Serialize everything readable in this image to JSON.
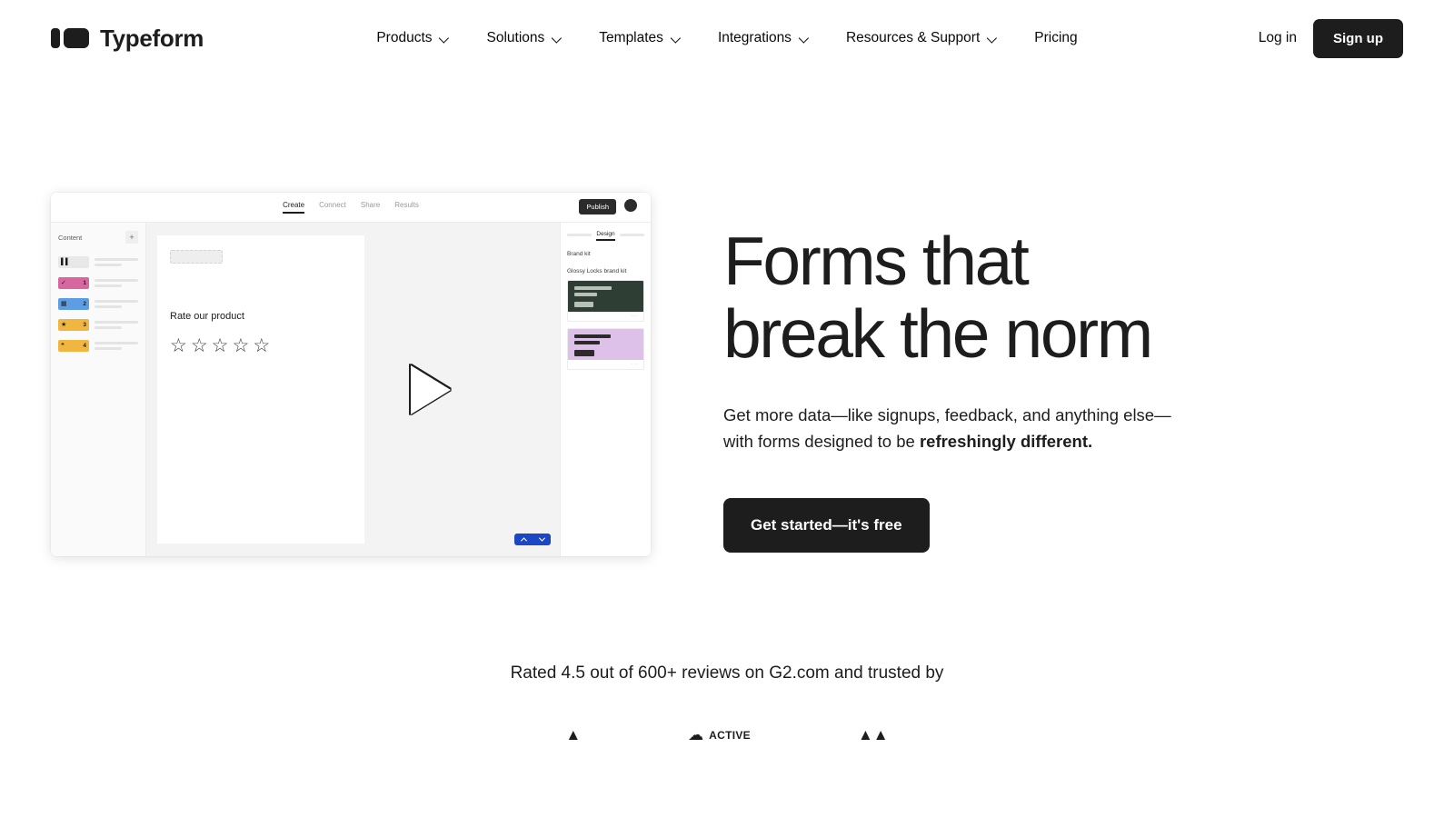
{
  "header": {
    "brand": {
      "name": "Typeform",
      "logo_icon": "typeform-logo-icon"
    },
    "nav": [
      {
        "label": "Products",
        "has_dropdown": true
      },
      {
        "label": "Solutions",
        "has_dropdown": true
      },
      {
        "label": "Templates",
        "has_dropdown": true
      },
      {
        "label": "Integrations",
        "has_dropdown": true
      },
      {
        "label": "Resources & Support",
        "has_dropdown": true
      },
      {
        "label": "Pricing",
        "has_dropdown": false
      }
    ],
    "login_label": "Log in",
    "signup_label": "Sign up"
  },
  "hero": {
    "title_line1": "Forms that",
    "title_line2": "break the norm",
    "sub_plain": "Get more data—like signups, feedback, and anything else—with forms designed to be ",
    "sub_bold": "refreshingly different.",
    "cta_label": "Get started—it's free"
  },
  "mockup": {
    "tabs": [
      {
        "label": "Create",
        "active": true
      },
      {
        "label": "Connect",
        "active": false
      },
      {
        "label": "Share",
        "active": false
      },
      {
        "label": "Results",
        "active": false
      }
    ],
    "publish_label": "Publish",
    "sidebar": {
      "title": "Content",
      "add_label": "+",
      "items": [
        {
          "num": "",
          "icon": "▌▌",
          "color": "#e8e8e8"
        },
        {
          "num": "1",
          "icon": "✓",
          "color": "#d8679f"
        },
        {
          "num": "2",
          "icon": "▦",
          "color": "#5d9de4"
        },
        {
          "num": "3",
          "icon": "★",
          "color": "#f0b63f"
        },
        {
          "num": "4",
          "icon": "❝",
          "color": "#f0b63f"
        }
      ]
    },
    "canvas": {
      "question": "Rate our product",
      "stars": [
        "☆",
        "☆",
        "☆",
        "☆",
        "☆"
      ],
      "nav_up_icon": "chevron-up-icon",
      "nav_down_icon": "chevron-down-icon",
      "accent_color": "#1c47c4"
    },
    "design_panel": {
      "tab_label": "Design",
      "brand_kit_label": "Brand kit",
      "kit_name": "Glossy Locks brand kit",
      "themes": [
        {
          "bg": "#2f3e35",
          "bar": "#b9c0ba"
        },
        {
          "bg": "#ddc1e8",
          "bar": "#2b2b2b"
        }
      ]
    }
  },
  "proof": {
    "text": "Rated 4.5 out of 600+ reviews on G2.com and trusted by",
    "logos": [
      {
        "icon": "▲",
        "label": ""
      },
      {
        "icon": "☁",
        "label": "ACTIVE"
      },
      {
        "icon": "▲▲",
        "label": ""
      }
    ]
  }
}
